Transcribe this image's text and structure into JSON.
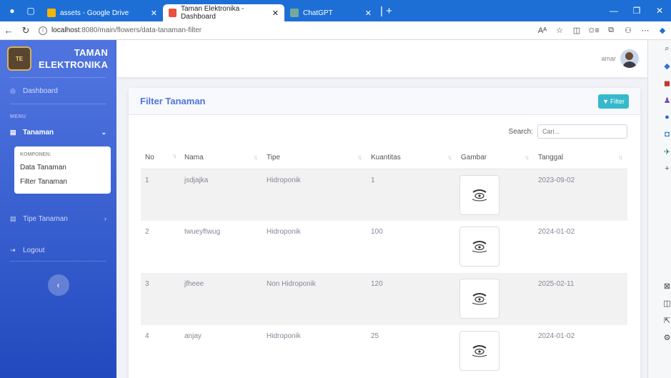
{
  "browser": {
    "tabs": [
      {
        "title": "assets - Google Drive"
      },
      {
        "title": "Taman Elektronika - Dashboard"
      },
      {
        "title": "ChatGPT"
      }
    ],
    "url_host": "localhost",
    "url_path": ":8080/main/flowers/data-tanaman-filter"
  },
  "brand": {
    "line1": "TAMAN",
    "line2": "ELEKTRONIKA"
  },
  "sidebar": {
    "dashboard": "Dashboard",
    "heading": "MENU",
    "tanaman": "Tanaman",
    "sub_heading": "KOMPONEN:",
    "sub_items": [
      "Data Tanaman",
      "Filter Tanaman"
    ],
    "tipe_tanaman": "Tipe Tanaman",
    "logout": "Logout"
  },
  "topbar": {
    "user": "amar"
  },
  "card": {
    "title": "Filter Tanaman",
    "filter_label": "Filter",
    "search_label": "Search:",
    "search_placeholder": "Cari..."
  },
  "table": {
    "headers": [
      "No",
      "Nama",
      "Tipe",
      "Kuantitas",
      "Gambar",
      "Tanggal"
    ],
    "rows": [
      {
        "no": "1",
        "nama": "jsdjajka",
        "tipe": "Hidroponik",
        "kuantitas": "1",
        "tanggal": "2023-09-02"
      },
      {
        "no": "2",
        "nama": "twueyftwug",
        "tipe": "Hidroponik",
        "kuantitas": "100",
        "tanggal": "2024-01-02"
      },
      {
        "no": "3",
        "nama": "jfheee",
        "tipe": "Non Hidroponik",
        "kuantitas": "120",
        "tanggal": "2025-02-11"
      },
      {
        "no": "4",
        "nama": "anjay",
        "tipe": "Hidroponik",
        "kuantitas": "25",
        "tanggal": "2024-01-02"
      }
    ]
  },
  "colors": {
    "primary": "#4e73df",
    "info": "#36b9cc",
    "browser": "#1d6fd6"
  }
}
